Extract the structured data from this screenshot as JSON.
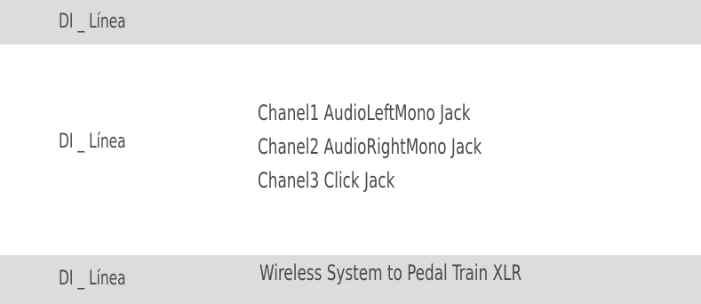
{
  "rows": [
    {
      "label": "DI _ Línea",
      "lines": []
    },
    {
      "label": "DI _ Línea",
      "lines": [
        "Chanel1 AudioLeftMono Jack",
        "Chanel2 AudioRightMono Jack",
        "Chanel3 Click Jack"
      ]
    },
    {
      "label": "DI _ Línea",
      "lines": [
        "Wireless System to Pedal Train XLR"
      ]
    }
  ],
  "colors": {
    "band": "#dcdcdc",
    "text": "#4a4a4a",
    "background": "#ffffff"
  }
}
